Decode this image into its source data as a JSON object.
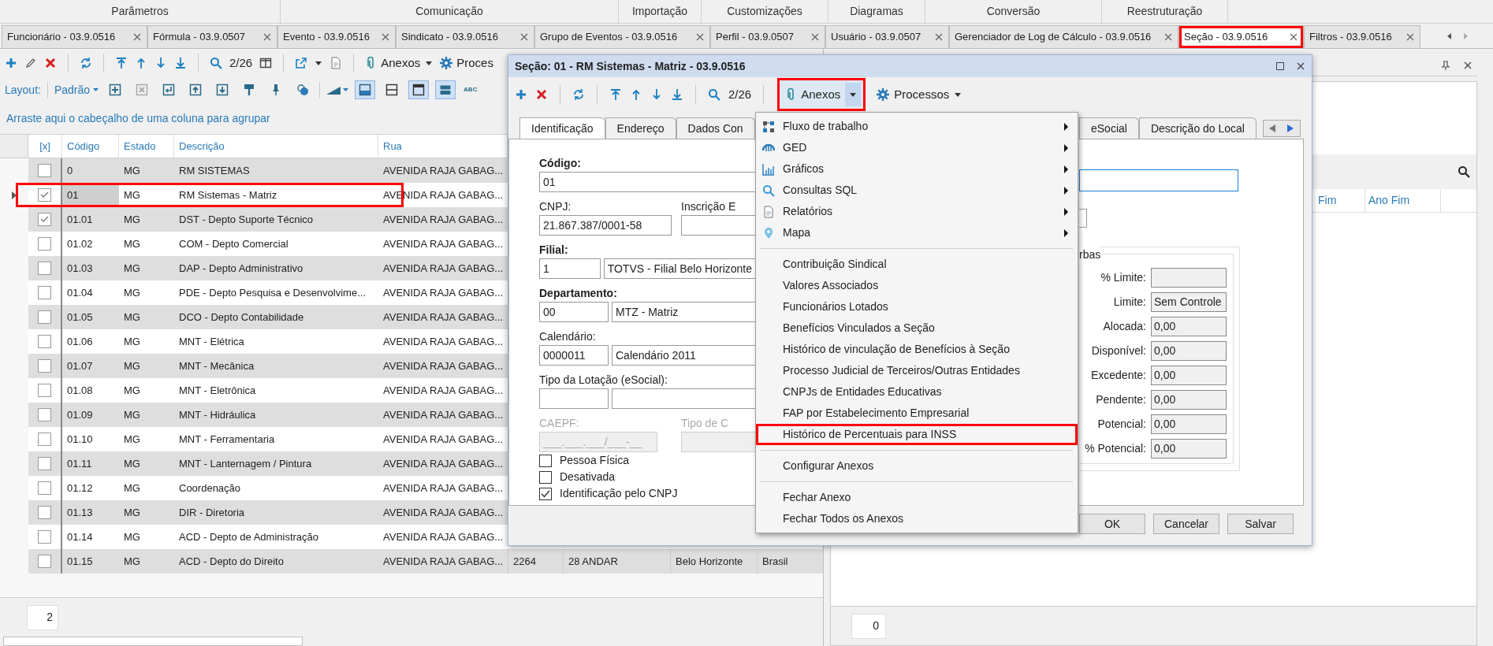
{
  "ribbon_groups": [
    "Parâmetros",
    "Comunicação",
    "Importação",
    "Customizações",
    "Diagramas",
    "Conversão",
    "Reestruturação"
  ],
  "document_tabs": [
    {
      "label": "Funcionário - 03.9.0516",
      "selected": false,
      "annotated": false
    },
    {
      "label": "Fórmula - 03.9.0507",
      "selected": false,
      "annotated": false
    },
    {
      "label": "Evento - 03.9.0516",
      "selected": false,
      "annotated": false
    },
    {
      "label": "Sindicato - 03.9.0516",
      "selected": false,
      "annotated": false
    },
    {
      "label": "Grupo de Eventos - 03.9.0516",
      "selected": false,
      "annotated": false
    },
    {
      "label": "Perfil - 03.9.0507",
      "selected": false,
      "annotated": false
    },
    {
      "label": "Usuário - 03.9.0507",
      "selected": false,
      "annotated": false
    },
    {
      "label": "Gerenciador de Log de Cálculo - 03.9.0516",
      "selected": false,
      "annotated": false
    },
    {
      "label": "Seção - 03.9.0516",
      "selected": true,
      "annotated": true
    },
    {
      "label": "Filtros - 03.9.0516",
      "selected": false,
      "annotated": false
    }
  ],
  "left_panel": {
    "toolbar": {
      "record_counter": "2/26",
      "attachments_label": "Anexos",
      "processes_label": "Proces"
    },
    "layout_bar": {
      "label": "Layout:",
      "preset": "Padrão",
      "view_toggles": [
        {
          "selected": true
        },
        {
          "selected": false
        },
        {
          "selected": true
        },
        {
          "selected": true
        }
      ],
      "spell_label": "ABC"
    },
    "group_hint": "Arraste aqui o cabeçalho de uma coluna para agrupar",
    "grid": {
      "checkbox_column_header": "[x]",
      "columns": [
        "Código",
        "Estado",
        "Descrição",
        "Rua"
      ],
      "rows": [
        {
          "checked": false,
          "selected": false,
          "annotated": false,
          "cells": [
            "0",
            "MG",
            "RM SISTEMAS",
            "AVENIDA RAJA GABAG..."
          ]
        },
        {
          "checked": true,
          "selected": true,
          "annotated": true,
          "cells": [
            "01",
            "MG",
            "RM Sistemas - Matriz",
            "AVENIDA RAJA GABAG..."
          ]
        },
        {
          "checked": true,
          "selected": false,
          "annotated": false,
          "cells": [
            "01.01",
            "MG",
            "DST - Depto Suporte Técnico",
            "AVENIDA RAJA GABAG..."
          ]
        },
        {
          "checked": false,
          "selected": false,
          "annotated": false,
          "cells": [
            "01.02",
            "MG",
            "COM - Depto Comercial",
            "AVENIDA RAJA GABAG..."
          ]
        },
        {
          "checked": false,
          "selected": false,
          "annotated": false,
          "cells": [
            "01.03",
            "MG",
            "DAP - Depto Administrativo",
            "AVENIDA RAJA GABAG..."
          ]
        },
        {
          "checked": false,
          "selected": false,
          "annotated": false,
          "cells": [
            "01.04",
            "MG",
            "PDE - Depto Pesquisa e Desenvolvime...",
            "AVENIDA RAJA GABAG..."
          ]
        },
        {
          "checked": false,
          "selected": false,
          "annotated": false,
          "cells": [
            "01.05",
            "MG",
            "DCO - Depto Contabilidade",
            "AVENIDA RAJA GABAG..."
          ]
        },
        {
          "checked": false,
          "selected": false,
          "annotated": false,
          "cells": [
            "01.06",
            "MG",
            "MNT - Elétrica",
            "AVENIDA RAJA GABAG..."
          ]
        },
        {
          "checked": false,
          "selected": false,
          "annotated": false,
          "cells": [
            "01.07",
            "MG",
            "MNT - Mecânica",
            "AVENIDA RAJA GABAG..."
          ]
        },
        {
          "checked": false,
          "selected": false,
          "annotated": false,
          "cells": [
            "01.08",
            "MG",
            "MNT - Eletrônica",
            "AVENIDA RAJA GABAG..."
          ]
        },
        {
          "checked": false,
          "selected": false,
          "annotated": false,
          "cells": [
            "01.09",
            "MG",
            "MNT - Hidráulica",
            "AVENIDA RAJA GABAG..."
          ]
        },
        {
          "checked": false,
          "selected": false,
          "annotated": false,
          "cells": [
            "01.10",
            "MG",
            "MNT - Ferramentaria",
            "AVENIDA RAJA GABAG..."
          ]
        },
        {
          "checked": false,
          "selected": false,
          "annotated": false,
          "cells": [
            "01.11",
            "MG",
            "MNT - Lanternagem / Pintura",
            "AVENIDA RAJA GABAG..."
          ]
        },
        {
          "checked": false,
          "selected": false,
          "annotated": false,
          "cells": [
            "01.12",
            "MG",
            "Coordenação",
            "AVENIDA RAJA GABAG..."
          ]
        },
        {
          "checked": false,
          "selected": false,
          "annotated": false,
          "cells": [
            "01.13",
            "MG",
            "DIR - Diretoria",
            "AVENIDA RAJA GABAG..."
          ]
        },
        {
          "checked": false,
          "selected": false,
          "annotated": false,
          "cells": [
            "01.14",
            "MG",
            "ACD - Depto de Administração",
            "AVENIDA RAJA GABAG..."
          ]
        },
        {
          "checked": false,
          "selected": false,
          "annotated": false,
          "cells": [
            "01.15",
            "MG",
            "ACD - Depto do Direito",
            "AVENIDA RAJA GABAG..."
          ],
          "extra_cells": [
            "2264",
            "28 ANDAR",
            "Belo Horizonte",
            "Brasil"
          ]
        }
      ]
    },
    "footer_count": "2"
  },
  "dialog": {
    "title": "Seção: 01 - RM Sistemas - Matriz - 03.9.0516",
    "toolbar": {
      "record_counter": "2/26",
      "attachments": {
        "label": "Anexos",
        "annotated": true
      },
      "processes_label": "Processos"
    },
    "tabs_left": [
      {
        "label": "Identificação",
        "selected": true
      },
      {
        "label": "Endereço",
        "selected": false
      },
      {
        "label": "Dados Con",
        "selected": false
      }
    ],
    "tabs_right": [
      {
        "label": "eSocial",
        "selected": false
      },
      {
        "label": "Descrição do Local",
        "selected": false
      }
    ],
    "form": {
      "codigo": {
        "label": "Código:",
        "required": true,
        "value": "01"
      },
      "cnpj": {
        "label": "CNPJ:",
        "required": false,
        "value": "21.867.387/0001-58"
      },
      "inscricao": {
        "label": "Inscrição E"
      },
      "filial": {
        "label": "Filial:",
        "required": true,
        "code": "1",
        "name": "TOTVS - Filial Belo Horizonte"
      },
      "departamento": {
        "label": "Departamento:",
        "required": true,
        "code": "00",
        "name": "MTZ - Matriz"
      },
      "calendario": {
        "label": "Calendário:",
        "required": false,
        "code": "0000011",
        "name": "Calendário 2011"
      },
      "tipo_lotacao": {
        "label": "Tipo da Lotação (eSocial):"
      },
      "caepf": {
        "label": "CAEPF:",
        "value": "___.___.___/___-__",
        "disabled": true
      },
      "tipo_c": {
        "label": "Tipo de C",
        "disabled": true
      }
    },
    "checkboxes": [
      {
        "label": "Pessoa Física",
        "checked": false
      },
      {
        "label": "Desativada",
        "checked": false
      },
      {
        "label": "Identificação pelo CNPJ",
        "checked": true
      }
    ],
    "name_field": {
      "focused": true
    },
    "budget_group": {
      "legend": "rbas",
      "rows": [
        {
          "label": "% Limite:"
        },
        {
          "label": "Limite:",
          "value": "Sem Controle"
        },
        {
          "label": "Alocada:",
          "value": "0,00"
        },
        {
          "label": "Disponível:",
          "value": "0,00"
        },
        {
          "label": "Excedente:",
          "value": "0,00"
        },
        {
          "label": "Pendente:",
          "value": "0,00"
        },
        {
          "label": "Potencial:",
          "value": "0,00"
        },
        {
          "label": "% Potencial:",
          "value": "0,00"
        }
      ]
    },
    "buttons": [
      "OK",
      "Cancelar",
      "Salvar"
    ]
  },
  "attachments_menu": {
    "items": [
      {
        "kind": "submenu",
        "label": "Fluxo de trabalho"
      },
      {
        "kind": "submenu",
        "label": "GED"
      },
      {
        "kind": "submenu",
        "label": "Gráficos"
      },
      {
        "kind": "submenu",
        "label": "Consultas SQL"
      },
      {
        "kind": "submenu",
        "label": "Relatórios"
      },
      {
        "kind": "submenu",
        "label": "Mapa"
      },
      {
        "kind": "separator"
      },
      {
        "kind": "action",
        "label": "Contribuição Sindical",
        "annotated": false
      },
      {
        "kind": "action",
        "label": "Valores Associados",
        "annotated": false
      },
      {
        "kind": "action",
        "label": "Funcionários Lotados",
        "annotated": false
      },
      {
        "kind": "action",
        "label": "Benefícios Vinculados a Seção",
        "annotated": false
      },
      {
        "kind": "action",
        "label": "Histórico de vinculação de Benefícios à Seção",
        "annotated": false
      },
      {
        "kind": "action",
        "label": "Processo Judicial de Terceiros/Outras Entidades",
        "annotated": false
      },
      {
        "kind": "action",
        "label": "CNPJs de Entidades Educativas",
        "annotated": false
      },
      {
        "kind": "action",
        "label": "FAP por Estabelecimento Empresarial",
        "annotated": false
      },
      {
        "kind": "action",
        "label": "Histórico de Percentuais para INSS",
        "annotated": true
      },
      {
        "kind": "separator"
      },
      {
        "kind": "action",
        "label": "Configurar Anexos",
        "annotated": false
      },
      {
        "kind": "separator"
      },
      {
        "kind": "action",
        "label": "Fechar Anexo",
        "annotated": false
      },
      {
        "kind": "action",
        "label": "Fechar Todos os Anexos",
        "annotated": false
      }
    ]
  },
  "right_panel": {
    "columns": [
      "Fim",
      "Ano Fim"
    ],
    "footer_count": "0"
  }
}
